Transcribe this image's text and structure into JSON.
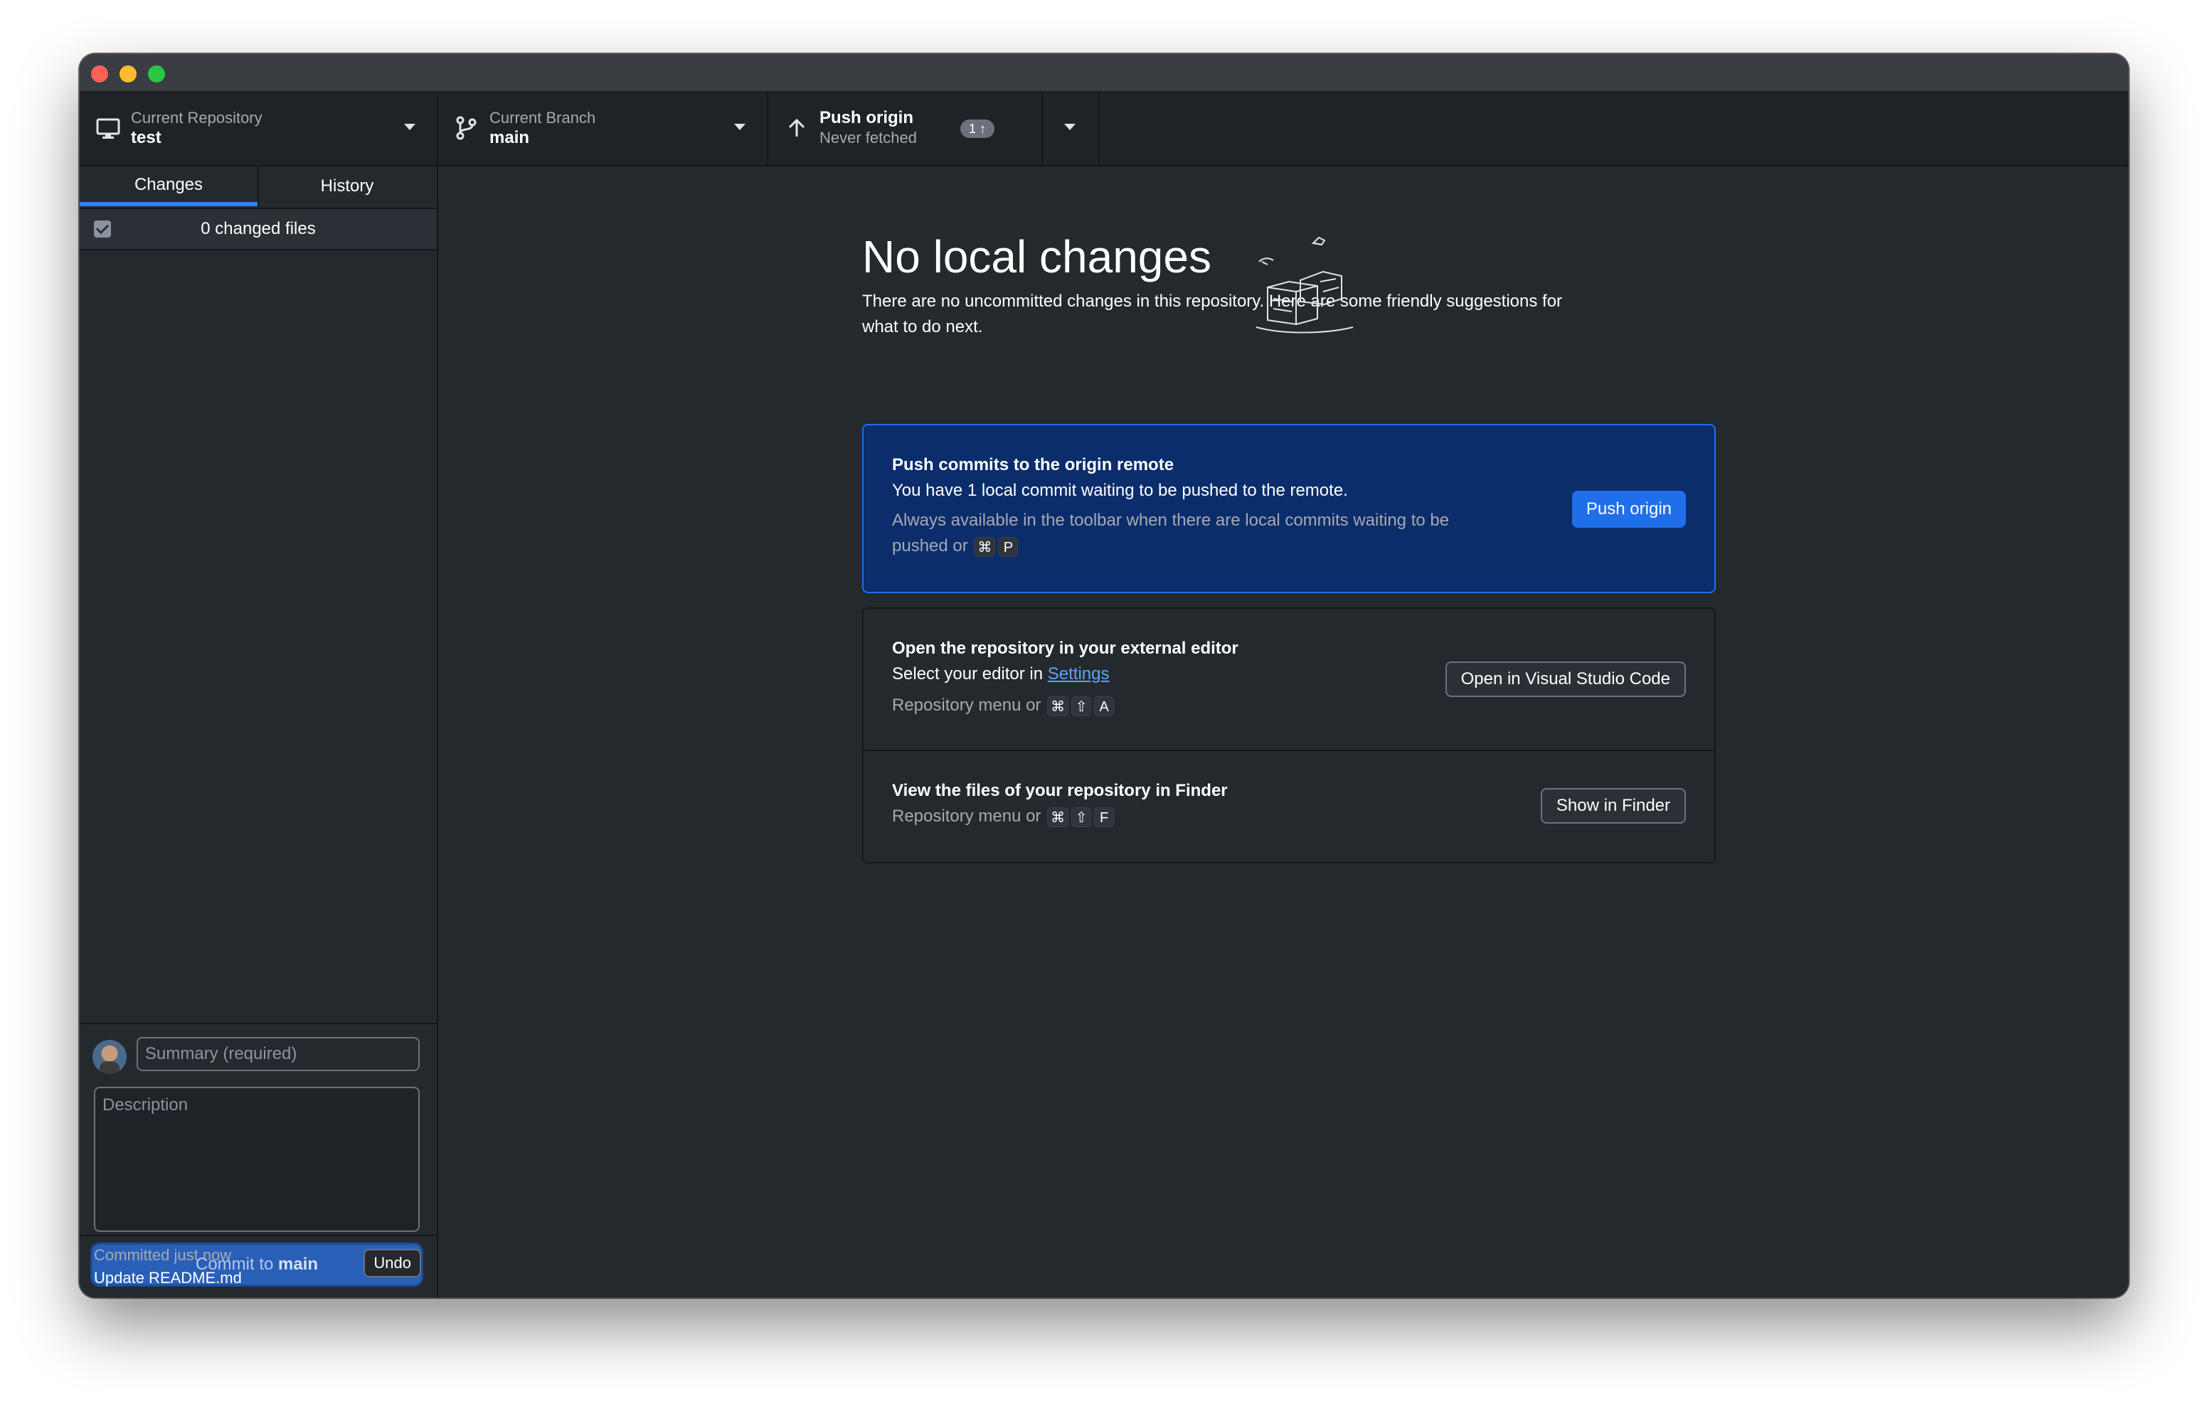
{
  "toolbar": {
    "repository": {
      "label": "Current Repository",
      "value": "test"
    },
    "branch": {
      "label": "Current Branch",
      "value": "main"
    },
    "push": {
      "label": "Push origin",
      "status": "Never fetched",
      "badge": "1 ↑"
    }
  },
  "sidebar": {
    "tabs": [
      {
        "label": "Changes"
      },
      {
        "label": "History"
      }
    ],
    "changed_files": "0 changed files",
    "summary_placeholder": "Summary (required)",
    "description_placeholder": "Description",
    "commit_button": {
      "prefix": "Commit to ",
      "branch": "main"
    },
    "last_commit": {
      "time": "Committed just now",
      "message": "Update README.md",
      "undo_label": "Undo"
    }
  },
  "main": {
    "heading": "No local changes",
    "subtext": "There are no uncommitted changes in this repository. Here are some friendly suggestions for what to do next.",
    "push_card": {
      "title": "Push commits to the origin remote",
      "description": "You have 1 local commit waiting to be pushed to the remote.",
      "hint": "Always available in the toolbar when there are local commits waiting to be pushed or",
      "shortcut": [
        "⌘",
        "P"
      ],
      "button": "Push origin"
    },
    "editor_card": {
      "title": "Open the repository in your external editor",
      "description": "Select your editor in",
      "link": "Settings",
      "hint": "Repository menu or",
      "shortcut": [
        "⌘",
        "⇧",
        "A"
      ],
      "button": "Open in Visual Studio Code"
    },
    "finder_card": {
      "title": "View the files of your repository in Finder",
      "hint": "Repository menu or",
      "shortcut": [
        "⌘",
        "⇧",
        "F"
      ],
      "button": "Show in Finder"
    }
  },
  "colors": {
    "accent": "#1f6feb",
    "push_card_bg": "#0c2d6b",
    "background": "#24292e"
  }
}
